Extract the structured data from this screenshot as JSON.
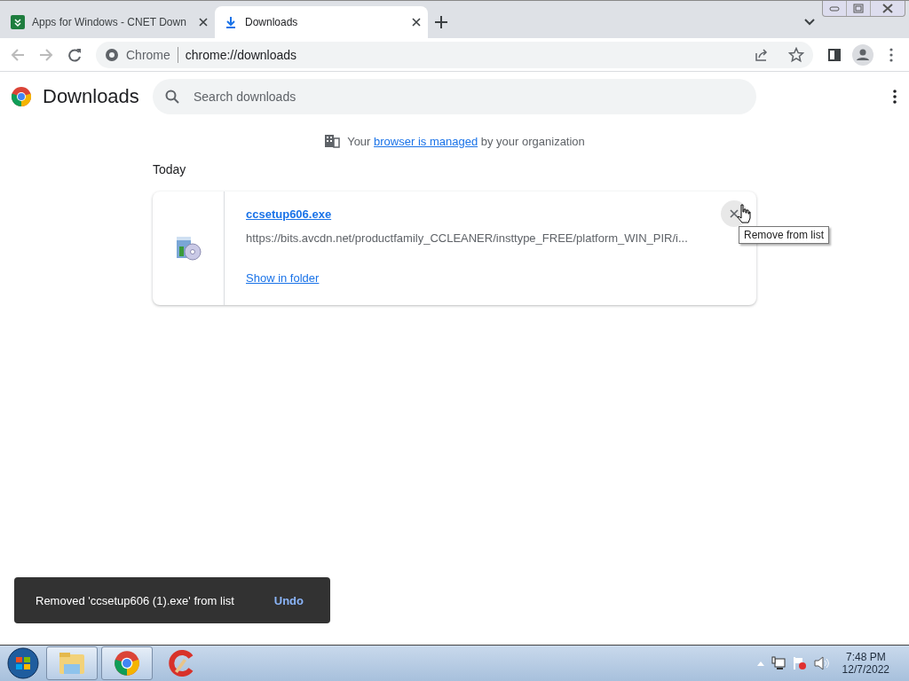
{
  "tabs": [
    {
      "title": "Apps for Windows - CNET Down",
      "selected": false
    },
    {
      "title": "Downloads",
      "selected": true
    }
  ],
  "address_bar": {
    "site": "Chrome",
    "url": "chrome://downloads"
  },
  "page": {
    "title": "Downloads",
    "search": {
      "placeholder": "Search downloads"
    },
    "managed_notice": {
      "before": "Your",
      "link": "browser is managed",
      "after": "by your organization"
    },
    "section": "Today",
    "download": {
      "filename": "ccsetup606.exe",
      "url": "https://bits.avcdn.net/productfamily_CCLEANER/insttype_FREE/platform_WIN_PIR/i...",
      "action": "Show in folder"
    },
    "tooltip": "Remove from list",
    "toast": {
      "message": "Removed 'ccsetup606 (1).exe' from list",
      "action": "Undo"
    }
  },
  "taskbar": {
    "apps": [
      {
        "kind": "explorer",
        "running": true
      },
      {
        "kind": "chrome",
        "running": true
      },
      {
        "kind": "ccleaner",
        "running": false
      }
    ],
    "time": "7:48 PM",
    "date": "12/7/2022"
  }
}
